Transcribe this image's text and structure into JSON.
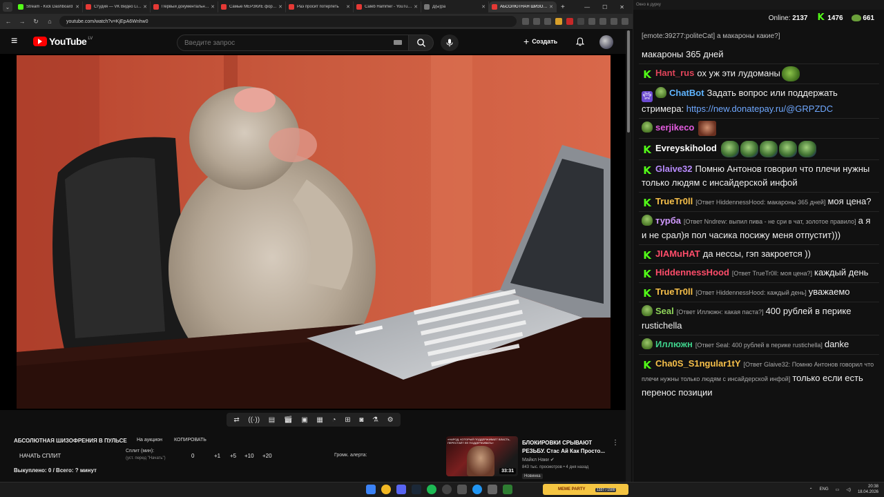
{
  "browser": {
    "tabs": [
      {
        "title": "Stream - Kick Dashboard",
        "color": "#53fc18",
        "active": false
      },
      {
        "title": "Студия — VK Видео Live",
        "color": "#e53935",
        "active": false
      },
      {
        "title": "Первый документальный",
        "color": "#e53935",
        "active": false
      },
      {
        "title": "Самые МЕРЗКИЕ форумы",
        "color": "#e53935",
        "active": false
      },
      {
        "title": "Раэ просит потерпеть",
        "color": "#e53935",
        "active": false
      },
      {
        "title": "Caleb Hammer - YouTube",
        "color": "#e53935",
        "active": false
      },
      {
        "title": "Д(ы)ра",
        "color": "#777777",
        "active": false
      },
      {
        "title": "АБСОЛЮТНАЯ ШИЗОФРЕНИЯ",
        "color": "#e53935",
        "active": true
      }
    ],
    "url": "youtube.com/watch?v=KjEpA6Wnhw0"
  },
  "youtube": {
    "logo_text": "YouTube",
    "region": "LV",
    "search_placeholder": "Введите запрос",
    "create_label": "Создать"
  },
  "extension": {
    "title": "АБСОЛЮТНАЯ ШИЗОФРЕНИЯ В ПУЛЬСЕ",
    "auction_label": "На аукцион",
    "copy_label": "КОПИРОВАТЬ",
    "start_split_label": "НАЧАТЬ СПЛИТ",
    "split_label": "Сплит (мин):",
    "split_hint": "(уст. перед \"Начать\")",
    "split_value": "0",
    "steps": [
      "+1",
      "+5",
      "+10",
      "+20"
    ],
    "alert_label": "Громк. алерта:",
    "bought_label": "Выкуплено: 0 / Всего: ? минут"
  },
  "recommended": {
    "thumb_caption": "«НАРОД, КОТОРЫЙ ПОДДЕРЖИВАЕТ ВЛАСТЬ, ПЕРЕСТАЁТ ЕЕ ПОДДЕРЖИВАТЬ»",
    "duration": "33:31",
    "title": "БЛОКИРОВКИ СРЫВАЮТ РЕЗЬБУ. Стас Ай Как Просто...",
    "channel": "Майкл Наки",
    "meta": "843 тыс. просмотров • 4 дня назад",
    "badge": "Новинка"
  },
  "chat": {
    "window_title": "Окно в дурку",
    "online_label": "Online:",
    "online_count": "2137",
    "kick_count": "1476",
    "pepe_count": "661",
    "messages": [
      {
        "badges": [],
        "user": "",
        "user_color": "#ffffff",
        "reply": "",
        "text": "[emote:39277:politeCat] а макароны какие?]",
        "small": true
      },
      {
        "badges": [],
        "user": "",
        "user_color": "#ffffff",
        "reply": "",
        "text": "макароны 365 дней"
      },
      {
        "badges": [
          "kick"
        ],
        "user": "Hant_rus",
        "user_color": "#e0445a",
        "reply": "",
        "text": "ох уж эти лудоманы",
        "emotes": [
          "pepe"
        ]
      },
      {
        "badges": [
          "bot",
          "pepe"
        ],
        "user": "ChatBot",
        "user_color": "#5fb4ff",
        "reply": "",
        "text": "Задать вопрос или поддержать стримера: ",
        "link": "https://new.donatepay.ru/@GRPZDC"
      },
      {
        "badges": [
          "pepe"
        ],
        "user": "serjikeco",
        "user_color": "#e45ce0",
        "reply": "",
        "text": "",
        "emotes": [
          "face"
        ]
      },
      {
        "badges": [
          "kick"
        ],
        "user": "Evreyskiholod",
        "user_color": "#ffffff",
        "reply": "",
        "text": "",
        "emotes": [
          "pepe-small",
          "pepe-small",
          "pepe-small",
          "pepe-small",
          "pepe-small"
        ]
      },
      {
        "badges": [
          "kick"
        ],
        "user": "Glaive32",
        "user_color": "#b98cff",
        "reply": "",
        "text": "Помню Антонов говорил что плечи нужны только людям с инсайдерской инфой"
      },
      {
        "badges": [
          "kick"
        ],
        "user": "TrueTr0ll",
        "user_color": "#f7c04a",
        "reply": "[Ответ HiddennessHood: макароны 365 дней]",
        "text": "моя цена?"
      },
      {
        "badges": [
          "pepe"
        ],
        "user": "турба",
        "user_color": "#d19aff",
        "reply": "[Ответ Nndrew: выпил пива - не сри в чат, золотое правило]",
        "text": "а я и не срал)я пол часика посижу меня отпустит)))"
      },
      {
        "badges": [
          "kick"
        ],
        "user": "JIAMuHAT",
        "user_color": "#ff4d6a",
        "reply": "",
        "text": "да нессы, гэп закроется ))"
      },
      {
        "badges": [
          "kick"
        ],
        "user": "HiddennessHood",
        "user_color": "#ff4d6a",
        "reply": "[Ответ TrueTr0ll: моя цена?]",
        "text": "каждый день"
      },
      {
        "badges": [
          "kick"
        ],
        "user": "TrueTr0ll",
        "user_color": "#f7c04a",
        "reply": "[Ответ HiddennessHood: каждый день]",
        "text": "уважаемо"
      },
      {
        "badges": [
          "pepe"
        ],
        "user": "Seal",
        "user_color": "#8fd45a",
        "reply": "[Ответ Иллюжн: какая паста?]",
        "text": "400 рублей в перике rustichella"
      },
      {
        "badges": [
          "pepe"
        ],
        "user": "Иллюжн",
        "user_color": "#3fd18b",
        "reply": "[Ответ Seal: 400 рублей в перике rustichella]",
        "text": "danke"
      },
      {
        "badges": [
          "kick"
        ],
        "user": "Cha0S_S1ngular1tY",
        "user_color": "#f7c04a",
        "reply": "[Ответ Glaive32: Помню Антонов говорил что плечи нужны только людям с инсайдерской инфой]",
        "text": "только если есть перенос позиции"
      }
    ]
  },
  "taskbar": {
    "meme_label": "MEME PARTY",
    "meme_counter": "1337 / 1500",
    "lang": "ENG",
    "time": "20:38",
    "date": "18.04.2026"
  }
}
